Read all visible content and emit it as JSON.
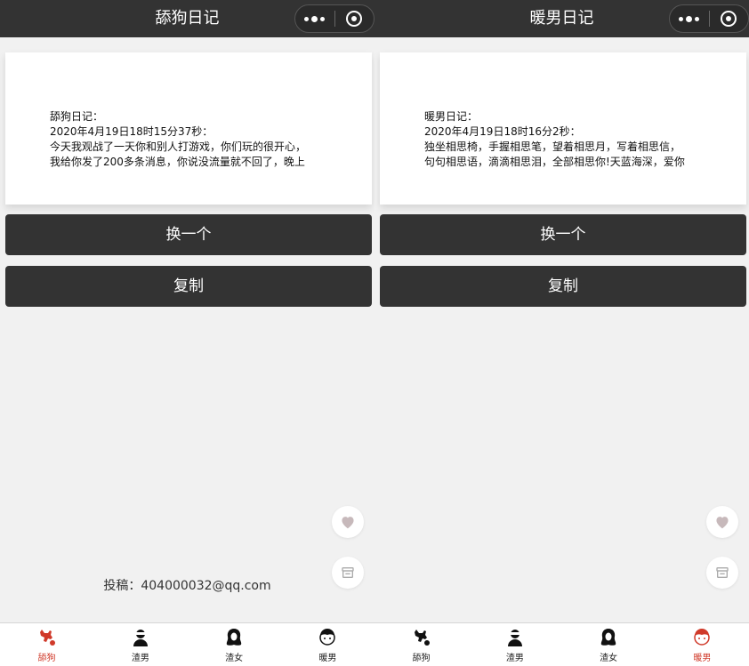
{
  "colors": {
    "accent": "#d03a2a",
    "nav_bg": "#333333",
    "button_bg": "#333333",
    "page_bg": "#f1f1f1"
  },
  "screens": [
    {
      "title": "舔狗日记",
      "card_lines": [
        "舔狗日记：",
        "2020年4月19日18时15分37秒：",
        "今天我观战了一天你和别人打游戏，你们玩的很开心，",
        "我给你发了200多条消息，你说没流量就不回了，晚上"
      ],
      "change_label": "换一个",
      "copy_label": "复制",
      "contribute": "投稿：404000032@qq.com",
      "show_contribute": true,
      "active_tab": 0
    },
    {
      "title": "暖男日记",
      "card_lines": [
        "暖男日记：",
        "2020年4月19日18时16分2秒：",
        "独坐相思椅，手握相思笔，望着相思月，写着相思信，",
        "句句相思语，滴滴相思泪，全部相思你!天蓝海深，爱你"
      ],
      "change_label": "换一个",
      "copy_label": "复制",
      "contribute": "",
      "show_contribute": false,
      "active_tab": 3
    }
  ],
  "tabs": [
    {
      "label": "舔狗",
      "icon": "dog-icon"
    },
    {
      "label": "渣男",
      "icon": "man-icon"
    },
    {
      "label": "渣女",
      "icon": "woman-icon"
    },
    {
      "label": "暖男",
      "icon": "boy-icon"
    }
  ]
}
